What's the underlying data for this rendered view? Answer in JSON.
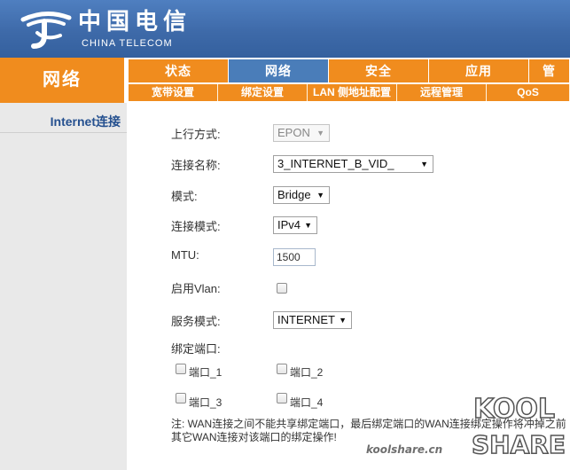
{
  "header": {
    "logo_cn": "中国电信",
    "logo_en": "CHINA TELECOM",
    "logo_icon": "china-telecom-logo-icon"
  },
  "nav": {
    "section_title": "网络",
    "main_tabs": [
      {
        "label": "状态",
        "active": false
      },
      {
        "label": "网络",
        "active": true
      },
      {
        "label": "安全",
        "active": false
      },
      {
        "label": "应用",
        "active": false
      },
      {
        "label": "管",
        "active": false
      }
    ],
    "sub_tabs": [
      "宽带设置",
      "绑定设置",
      "LAN 侧地址配置",
      "远程管理",
      "QoS"
    ]
  },
  "sidebar": {
    "items": [
      {
        "label": "Internet连接"
      }
    ]
  },
  "form": {
    "uplink_label": "上行方式:",
    "uplink_value": "EPON",
    "connection_name_label": "连接名称:",
    "connection_name_value": "3_INTERNET_B_VID_",
    "mode_label": "模式:",
    "mode_value": "Bridge",
    "conn_mode_label": "连接模式:",
    "conn_mode_value": "IPv4",
    "mtu_label": "MTU:",
    "mtu_value": "1500",
    "vlan_label": "启用Vlan:",
    "service_mode_label": "服务模式:",
    "service_mode_value": "INTERNET",
    "bind_port_label": "绑定端口:",
    "ports": [
      "端口_1",
      "端口_2",
      "端口_3",
      "端口_4"
    ],
    "note": "注: WAN连接之间不能共享绑定端口，最后绑定端口的WAN连接绑定操作将冲掉之前其它WAN连接对该端口的绑定操作!"
  },
  "watermark": {
    "site": "koolshare.cn",
    "logo_top": "KOOL",
    "logo_bottom": "SHARE"
  },
  "colors": {
    "header_blue": "#3f6eb0",
    "nav_orange": "#f08c1e",
    "active_tab_blue": "#4a7db9",
    "sidebar_bg": "#e9e9e9",
    "sidebar_text": "#25508f"
  }
}
